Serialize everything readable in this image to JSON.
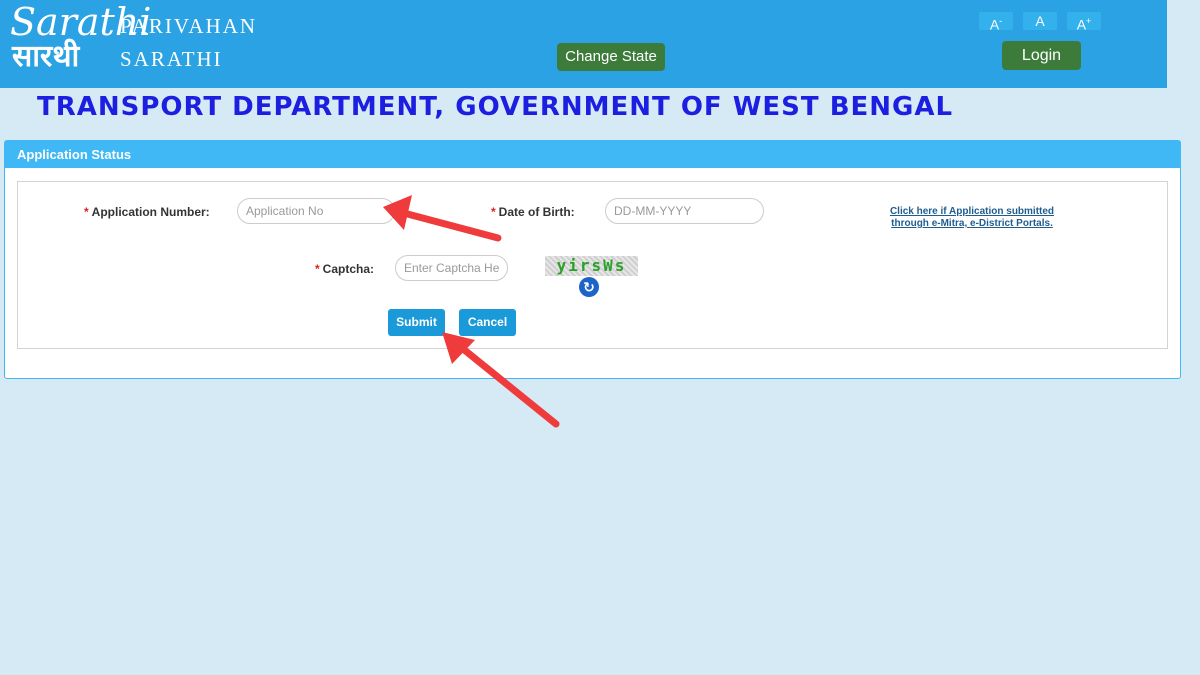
{
  "header": {
    "logo_en": "Sarathi",
    "logo_hi": "सारथी",
    "brand_line1": "PARIVAHAN",
    "brand_line2": "SARATHI",
    "change_state": "Change State",
    "font_decrease": "A",
    "font_decrease_sign": "-",
    "font_normal": "A",
    "font_increase": "A",
    "font_increase_sign": "+",
    "login": "Login"
  },
  "department_title": "TRANSPORT DEPARTMENT, GOVERNMENT OF WEST BENGAL",
  "panel": {
    "title": "Application Status",
    "required_mark": "*",
    "application_number_label": "Application Number:",
    "application_number_placeholder": "Application No",
    "dob_label": "Date of Birth:",
    "dob_placeholder": "DD-MM-YYYY",
    "captcha_label": "Captcha:",
    "captcha_placeholder": "Enter Captcha Here",
    "captcha_text": "yirsWs",
    "emitra_link_line1": "Click here if Application submitted",
    "emitra_link_line2": "through e-Mitra, e-District Portals.",
    "submit": "Submit",
    "cancel": "Cancel"
  },
  "colors": {
    "header_bg": "#2aa2e3",
    "page_bg": "#d6eaf6",
    "title": "#1c1ee0",
    "green_button": "#3d7b3a",
    "primary_button": "#1a9ad8",
    "annotation_arrow": "#ef3b3b"
  },
  "icons": {
    "refresh": "refresh-captcha-icon"
  }
}
